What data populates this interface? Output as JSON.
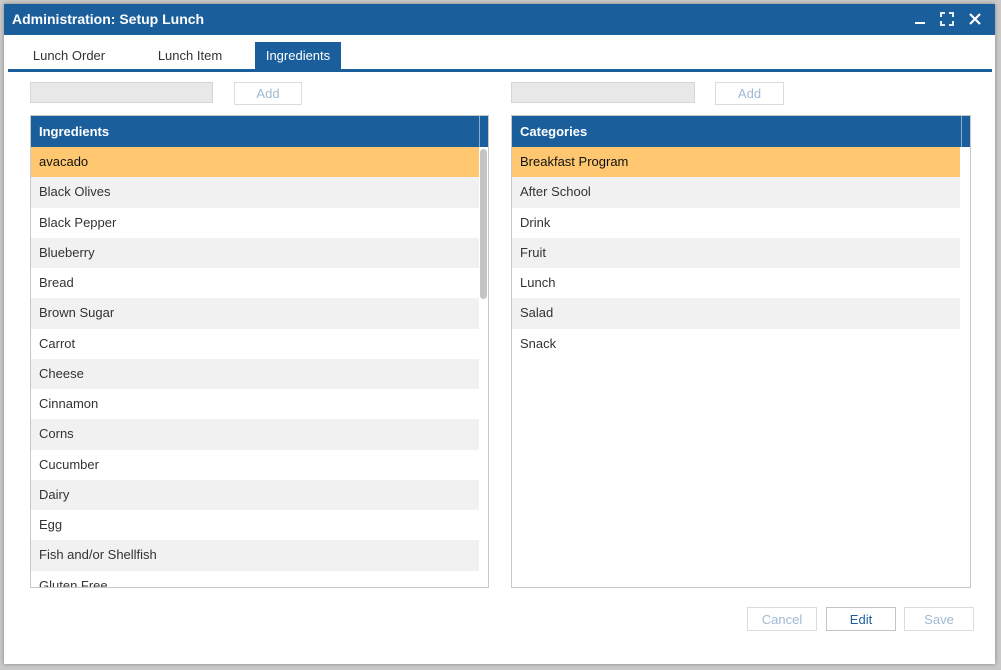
{
  "window": {
    "title": "Administration: Setup Lunch"
  },
  "tabs": [
    {
      "label": "Lunch Order"
    },
    {
      "label": "Lunch Item"
    },
    {
      "label": "Ingredients"
    }
  ],
  "ingredients": {
    "add_label": "Add",
    "input_value": "",
    "header": "Ingredients",
    "items": [
      "avacado",
      "Black Olives",
      "Black Pepper",
      "Blueberry",
      "Bread",
      "Brown Sugar",
      "Carrot",
      "Cheese",
      "Cinnamon",
      "Corns",
      "Cucumber",
      "Dairy",
      "Egg",
      "Fish and/or Shellfish",
      "Gluten Free"
    ],
    "selected_index": 0
  },
  "categories": {
    "add_label": "Add",
    "input_value": "",
    "header": "Categories",
    "items": [
      "Breakfast Program",
      "After School",
      "Drink",
      "Fruit",
      "Lunch",
      "Salad",
      "Snack"
    ],
    "selected_index": 0
  },
  "footer": {
    "cancel_label": "Cancel",
    "edit_label": "Edit",
    "save_label": "Save"
  },
  "icons": {
    "minimize": "minimize-icon",
    "maximize": "maximize-icon",
    "close": "close-icon"
  },
  "colors": {
    "accent": "#1a5f9c",
    "selected_row": "#ffc870",
    "alt_row": "#f1f1f1"
  }
}
